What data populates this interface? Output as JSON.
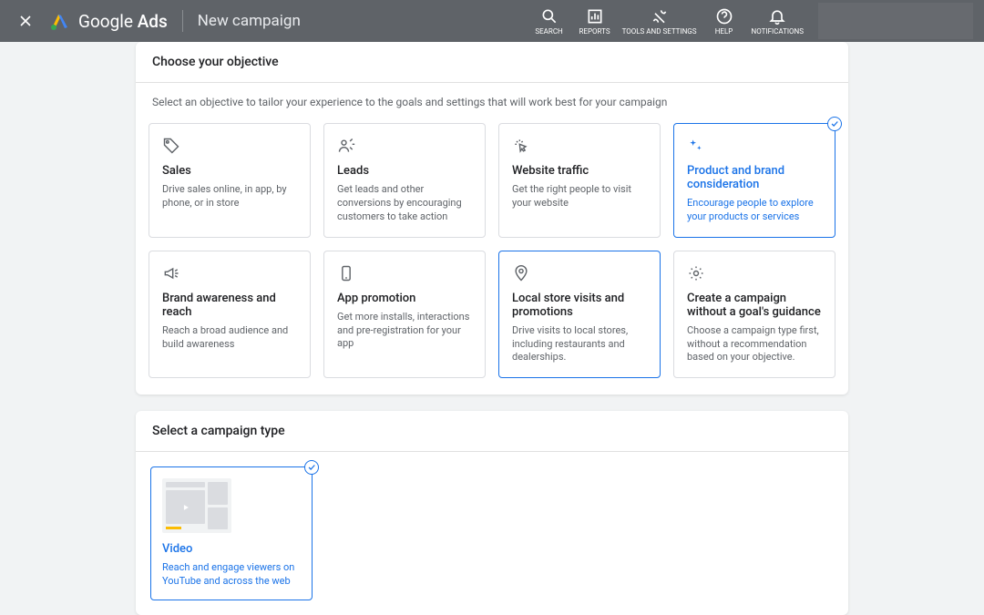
{
  "header": {
    "brand_light": "Google",
    "brand_bold": "Ads",
    "page_title": "New campaign",
    "tools": {
      "search": "SEARCH",
      "reports": "REPORTS",
      "tools_settings": "TOOLS AND SETTINGS",
      "help": "HELP",
      "notifications": "NOTIFICATIONS"
    }
  },
  "objective_panel": {
    "title": "Choose your objective",
    "subtitle": "Select an objective to tailor your experience to the goals and settings that will work best for your campaign",
    "cards": {
      "sales": {
        "title": "Sales",
        "desc": "Drive sales online, in app, by phone, or in store"
      },
      "leads": {
        "title": "Leads",
        "desc": "Get leads and other conversions by encouraging customers to take action"
      },
      "traffic": {
        "title": "Website traffic",
        "desc": "Get the right people to visit your website"
      },
      "product_brand": {
        "title": "Product and brand consideration",
        "desc": "Encourage people to explore your products or services"
      },
      "awareness": {
        "title": "Brand awareness and reach",
        "desc": "Reach a broad audience and build awareness"
      },
      "app": {
        "title": "App promotion",
        "desc": "Get more installs, interactions and pre-registration for your app"
      },
      "local": {
        "title": "Local store visits and promotions",
        "desc": "Drive visits to local stores, including restaurants and dealerships."
      },
      "noguide": {
        "title": "Create a campaign without a goal's guidance",
        "desc": "Choose a campaign type first, without a recommendation based on your objective."
      }
    }
  },
  "type_panel": {
    "title": "Select a campaign type",
    "video": {
      "title": "Video",
      "desc": "Reach and engage viewers on YouTube and across the web"
    }
  }
}
